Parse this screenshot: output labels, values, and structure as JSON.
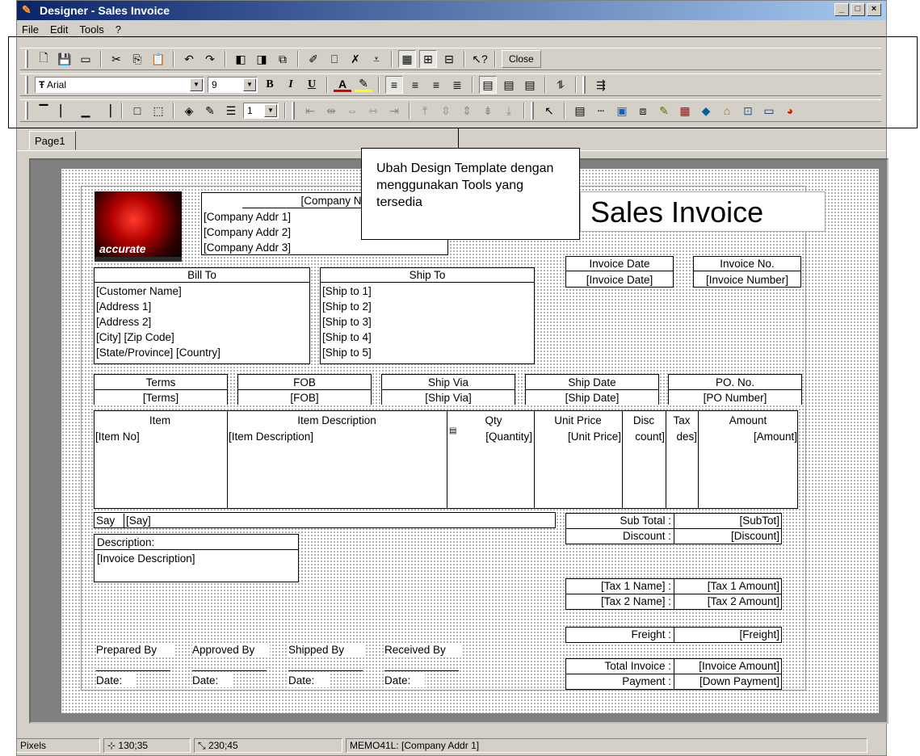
{
  "window": {
    "title": "Designer - Sales Invoice",
    "minimize": "_",
    "maximize": "□",
    "close": "×"
  },
  "menu": [
    "File",
    "Edit",
    "Tools",
    "?"
  ],
  "toolbar": {
    "close_label": "Close",
    "font_name": "Arial",
    "font_size": "9",
    "line_width": "1"
  },
  "tab": {
    "label": "Page1"
  },
  "callout": {
    "text": "Ubah Design Template dengan menggunakan Tools yang tersedia"
  },
  "invoice": {
    "title": "Sales Invoice",
    "company": {
      "name": "[Company Name]",
      "addr1": "[Company Addr 1]",
      "addr2": "[Company Addr 2]",
      "addr3": "[Company Addr 3]"
    },
    "logo_text": "accurate",
    "bill_to": {
      "header": "Bill To",
      "lines": [
        "[Customer Name]",
        "[Address 1]",
        "[Address 2]",
        "[City] [Zip Code]",
        "[State/Province] [Country]"
      ]
    },
    "ship_to": {
      "header": "Ship To",
      "lines": [
        "[Ship to 1]",
        "[Ship to 2]",
        "[Ship to 3]",
        "[Ship to 4]",
        "[Ship to 5]"
      ]
    },
    "invoice_date": {
      "header": "Invoice Date",
      "value": "[Invoice Date]"
    },
    "invoice_no": {
      "header": "Invoice No.",
      "value": "[Invoice Number]"
    },
    "terms_row": [
      {
        "header": "Terms",
        "value": "[Terms]"
      },
      {
        "header": "FOB",
        "value": "[FOB]"
      },
      {
        "header": "Ship Via",
        "value": "[Ship Via]"
      },
      {
        "header": "Ship Date",
        "value": "[Ship Date]"
      },
      {
        "header": "PO. No.",
        "value": "[PO Number]"
      }
    ],
    "items": {
      "columns": [
        "Item",
        "Item Description",
        "Qty",
        "Unit Price",
        "Disc",
        "Tax",
        "Amount"
      ],
      "values": [
        "[Item No]",
        "[Item Description]",
        "[Quantity]",
        "[Unit Price]",
        "count]",
        "des]",
        "[Amount]"
      ]
    },
    "say": {
      "label": "Say",
      "value": "[Say]"
    },
    "description": {
      "label": "Description:",
      "value": "[Invoice Description]"
    },
    "totals": [
      {
        "label": "Sub Total :",
        "value": "[SubTot]"
      },
      {
        "label": "Discount :",
        "value": "[Discount]"
      }
    ],
    "taxes": [
      {
        "label": "[Tax 1 Name] :",
        "value": "[Tax 1 Amount]"
      },
      {
        "label": "[Tax 2 Name] :",
        "value": "[Tax 2 Amount]"
      }
    ],
    "freight": {
      "label": "Freight :",
      "value": "[Freight]"
    },
    "total_invoice": {
      "label": "Total Invoice :",
      "value": "[Invoice Amount]"
    },
    "payment": {
      "label": "Payment :",
      "value": "[Down Payment]"
    },
    "signatures": [
      {
        "label": "Prepared By",
        "date": "Date:"
      },
      {
        "label": "Approved By",
        "date": "Date:"
      },
      {
        "label": "Shipped By",
        "date": "Date:"
      },
      {
        "label": "Received By",
        "date": "Date:"
      }
    ]
  },
  "status": {
    "units": "Pixels",
    "position": "130;35",
    "size": "230;45",
    "selection": "MEMO41L: [Company Addr 1]"
  }
}
